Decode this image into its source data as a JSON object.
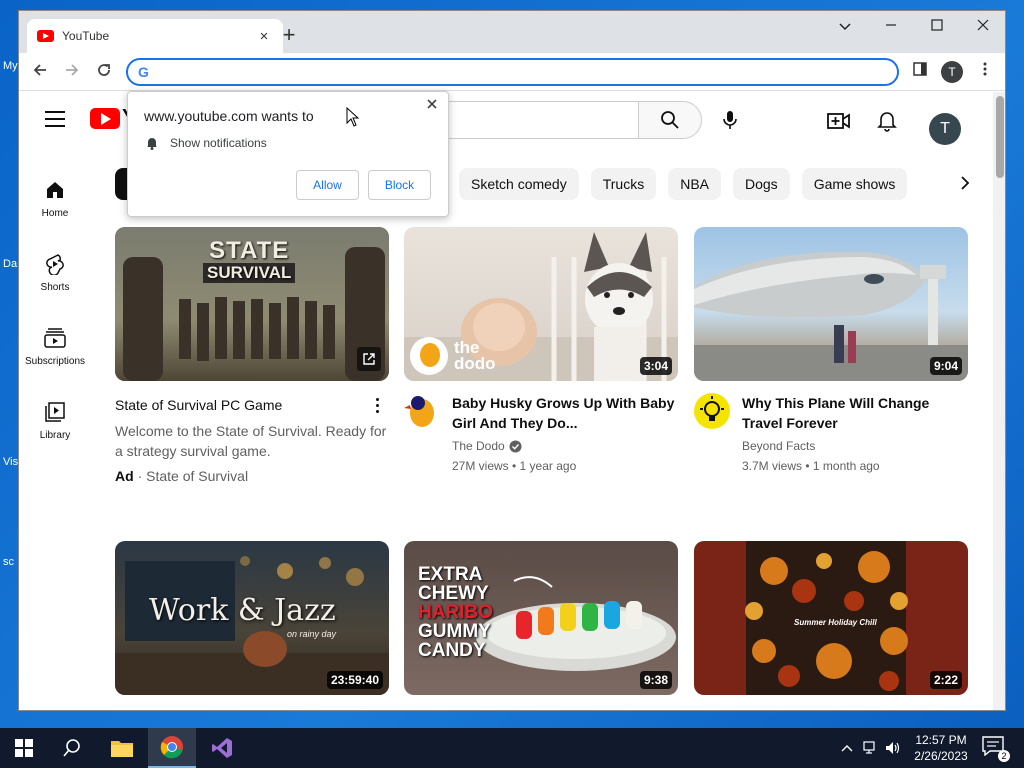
{
  "desktop": {
    "side_labels": [
      "My",
      "Da",
      "Vis",
      "sc"
    ]
  },
  "browser": {
    "tab_title": "YouTube",
    "new_tab_symbol": "+",
    "tab_close_symbol": "×",
    "omnibox_value": "",
    "profile_initial": "T",
    "window_controls": [
      "⌄",
      "—",
      "☐",
      "✕"
    ]
  },
  "youtube": {
    "logo_text": "Y",
    "avatar_initial": "T",
    "sidebar": [
      {
        "label": "Home",
        "icon": "home-icon"
      },
      {
        "label": "Shorts",
        "icon": "shorts-icon"
      },
      {
        "label": "Subscriptions",
        "icon": "subscriptions-icon"
      },
      {
        "label": "Library",
        "icon": "library-icon"
      }
    ],
    "chips": [
      "Sketch comedy",
      "Trucks",
      "NBA",
      "Dogs",
      "Game shows"
    ],
    "ad": {
      "title": "State of Survival PC Game",
      "description": "Welcome to the State of Survival. Ready for a strategy survival game.",
      "badge": "Ad",
      "separator": "·",
      "advertiser": "State of Survival",
      "thumb_text_line1": "STATE",
      "thumb_text_line2": "SURVIVAL"
    },
    "videos": [
      {
        "title": "Baby Husky Grows Up With Baby Girl And They Do...",
        "channel": "The Dodo",
        "verified": true,
        "stats": "27M views • 1 year ago",
        "duration": "3:04",
        "thumb_text": "the dodo",
        "avatar_color": "#f2a516"
      },
      {
        "title": "Why This Plane Will Change Travel Forever",
        "channel": "Beyond Facts",
        "verified": false,
        "stats": "3.7M views • 1 month ago",
        "duration": "9:04",
        "avatar_color": "#f5e400"
      }
    ],
    "row2": [
      {
        "duration": "23:59:40",
        "thumb_text": "Work & Jazz",
        "thumb_subtext": "on rainy day"
      },
      {
        "duration": "9:38",
        "thumb_text_lines": [
          "EXTRA",
          "CHEWY",
          "HARIBO",
          "GUMMY",
          "CANDY"
        ]
      },
      {
        "duration": "2:22",
        "thumb_text": "Summer Holiday Chill"
      }
    ]
  },
  "permission_popup": {
    "title": "www.youtube.com wants to",
    "permission": "Show notifications",
    "allow_label": "Allow",
    "block_label": "Block"
  },
  "taskbar": {
    "time": "12:57 PM",
    "date": "2/26/2023",
    "notification_count": "2"
  },
  "colors": {
    "accent": "#1a73e8",
    "youtube_red": "#ff0000",
    "desktop_blue": "#0a64c8",
    "taskbar": "#101a2c"
  }
}
